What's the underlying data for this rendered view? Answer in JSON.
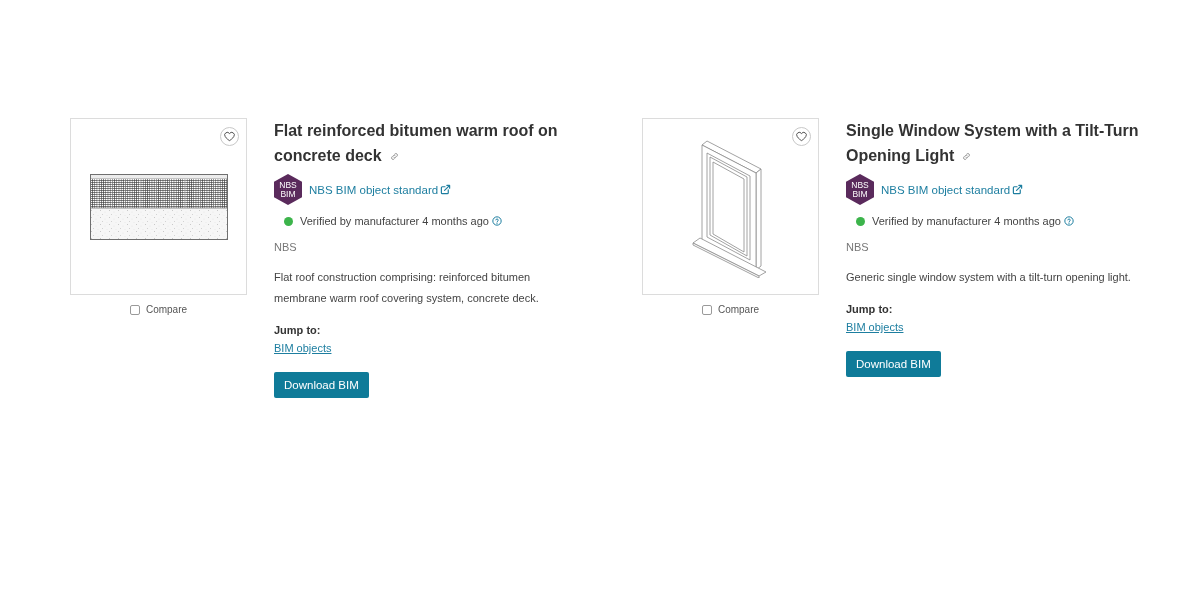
{
  "products": [
    {
      "kind": "roof-section",
      "favorite": false,
      "compare": {
        "label": "Compare",
        "checked": false
      },
      "title": "Flat reinforced bitumen warm roof on concrete deck",
      "standard": {
        "badge": "NBS BIM",
        "link": "NBS BIM object standard"
      },
      "verified": true,
      "verification": "Verified by manufacturer 4 months ago",
      "manufacturer": "NBS",
      "description": "Flat roof construction comprising: reinforced bitumen membrane warm roof covering system, concrete deck.",
      "jump_to": {
        "label": "Jump to:",
        "links": [
          "BIM objects"
        ]
      },
      "button": "Download BIM"
    },
    {
      "kind": "window",
      "favorite": false,
      "compare": {
        "label": "Compare",
        "checked": false
      },
      "title": "Single Window System with a Tilt-Turn Opening Light",
      "standard": {
        "badge": "NBS BIM",
        "link": "NBS BIM object standard"
      },
      "verified": true,
      "verification": "Verified by manufacturer 4 months ago",
      "manufacturer": "NBS",
      "description": "Generic single window system with a tilt-turn opening light.",
      "jump_to": {
        "label": "Jump to:",
        "links": [
          "BIM objects"
        ]
      },
      "button": "Download BIM"
    }
  ]
}
